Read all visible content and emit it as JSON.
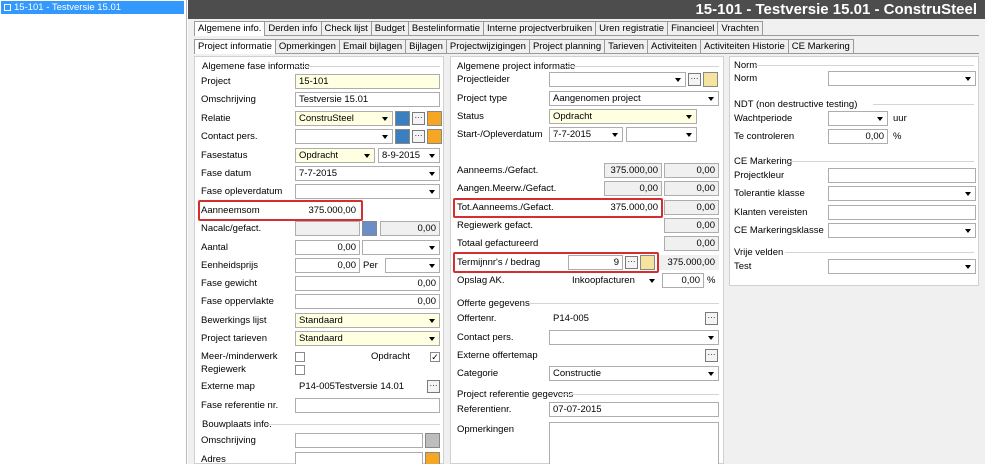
{
  "tree": {
    "item": "15-101 - Testversie 15.01"
  },
  "title": "15-101 - Testversie 15.01 - ConstruSteel",
  "tabs1": [
    "Algemene info.",
    "Derden info",
    "Check lijst",
    "Budget",
    "Bestelinformatie",
    "Interne projectverbruiken",
    "Uren registratie",
    "Financieel",
    "Vrachten"
  ],
  "tabs2": [
    "Project informatie",
    "Opmerkingen",
    "Email bijlagen",
    "Bijlagen",
    "Projectwijzigingen",
    "Project planning",
    "Tarieven",
    "Activiteiten",
    "Activiteiten Historie",
    "CE Markering"
  ],
  "left": {
    "section": "Algemene fase informatie",
    "project_label": "Project",
    "project_value": "15-101",
    "omschrijving_label": "Omschrijving",
    "omschrijving_value": "Testversie 15.01",
    "relatie_label": "Relatie",
    "relatie_value": "ConstruSteel",
    "contact_label": "Contact pers.",
    "fasestatus_label": "Fasestatus",
    "fasestatus_value": "Opdracht",
    "fasestatus_date": "8-9-2015",
    "fasedatum_label": "Fase datum",
    "fasedatum_value": "7-7-2015",
    "opleverdatum_label": "Fase opleverdatum",
    "aanneemsom_label": "Aanneemsom",
    "aanneemsom_value": "375.000,00",
    "nacalc_label": "Nacalc/gefact.",
    "nacalc_value": "0,00",
    "aantal_label": "Aantal",
    "aantal_value": "0,00",
    "eenheidsprijs_label": "Eenheidsprijs",
    "eenheidsprijs_value": "0,00",
    "per_label": "Per",
    "gewicht_label": "Fase gewicht",
    "gewicht_value": "0,00",
    "oppervlakte_label": "Fase oppervlakte",
    "oppervlakte_value": "0,00",
    "bewerkings_label": "Bewerkings lijst",
    "bewerkings_value": "Standaard",
    "tarieven_label": "Project tarieven",
    "tarieven_value": "Standaard",
    "meerminder_label": "Meer-/minderwerk",
    "opdracht_label": "Opdracht",
    "regiewerk_label": "Regiewerk",
    "externe_label": "Externe map",
    "externe_value": "P14-005Testversie 14.01",
    "fasereferentie_label": "Fase referentie nr.",
    "bouwplaats_section": "Bouwplaats info.",
    "bp_omschrijving_label": "Omschrijving",
    "bp_adres_label": "Adres"
  },
  "middle": {
    "section": "Algemene project informatie",
    "projectleider_label": "Projectleider",
    "projecttype_label": "Project type",
    "projecttype_value": "Aangenomen project",
    "status_label": "Status",
    "status_value": "Opdracht",
    "start_label": "Start-/Opleverdatum",
    "start_value": "7-7-2015",
    "aanneems_label": "Aanneems./Gefact.",
    "aanneems_v1": "375.000,00",
    "aanneems_v2": "0,00",
    "aangen_label": "Aangen.Meerw./Gefact.",
    "aangen_v1": "0,00",
    "aangen_v2": "0,00",
    "tot_label": "Tot.Aanneems./Gefact.",
    "tot_v1": "375.000,00",
    "tot_v2": "0,00",
    "regiewerk_label": "Regiewerk gefact.",
    "regiewerk_value": "0,00",
    "totaal_label": "Totaal gefactureerd",
    "totaal_value": "0,00",
    "termijn_label": "Termijnnr's / bedrag",
    "termijn_nr": "9",
    "termijn_bedrag": "375.000,00",
    "opslag_label": "Opslag AK.",
    "opslag_value": "Inkoopfacturen",
    "opslag_pct": "0,00",
    "pct_sign": "%",
    "offerte_section": "Offerte gegevens",
    "offertenr_label": "Offertenr.",
    "offertenr_value": "P14-005",
    "contact_label": "Contact pers.",
    "externe_label": "Externe offertemap",
    "categorie_label": "Categorie",
    "categorie_value": "Constructie",
    "ref_section": "Project referentie gegevens",
    "referentienr_label": "Referentienr.",
    "referentienr_value": "07-07-2015",
    "opmerkingen_label": "Opmerkingen"
  },
  "right": {
    "norm_section": "Norm",
    "norm_label": "Norm",
    "ndt_section": "NDT (non destructive testing)",
    "wachtperiode_label": "Wachtperiode",
    "wachtperiode_unit": "uur",
    "tecontroleren_label": "Te controleren",
    "tecontroleren_value": "0,00",
    "tecontroleren_unit": "%",
    "ce_section": "CE Markering",
    "projectkleur_label": "Projectkleur",
    "tolerantie_label": "Tolerantie klasse",
    "klanten_label": "Klanten vereisten",
    "cemk_label": "CE Markeringsklasse",
    "vrije_section": "Vrije velden",
    "test_label": "Test"
  }
}
